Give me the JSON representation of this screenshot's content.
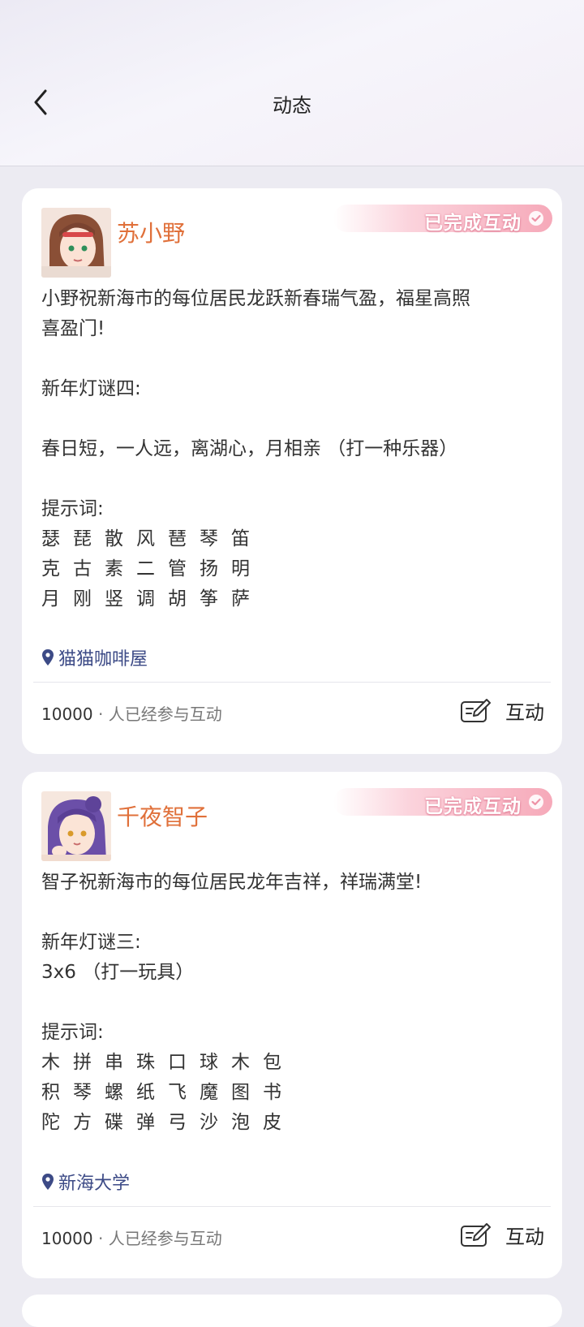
{
  "header": {
    "title": "动态"
  },
  "posts": [
    {
      "author": "苏小野",
      "badge": "已完成互动",
      "body": [
        "小野祝新海市的每位居民龙跃新春瑞气盈，福星高照",
        "喜盈门!",
        "",
        "新年灯谜四:",
        "",
        "春日短，一人远，离湖心，月相亲 （打一种乐器）",
        "",
        "提示词:"
      ],
      "hints": [
        [
          "瑟",
          "琵",
          "散",
          "风",
          "琶",
          "琴",
          "笛"
        ],
        [
          "克",
          "古",
          "素",
          "二",
          "管",
          "扬",
          "明"
        ],
        [
          "月",
          "刚",
          "竖",
          "调",
          "胡",
          "筝",
          "萨"
        ]
      ],
      "location": "猫猫咖啡屋",
      "count": "10000",
      "count_suffix": "· 人已经参与互动",
      "interact_label": "互动"
    },
    {
      "author": "千夜智子",
      "badge": "已完成互动",
      "body": [
        "智子祝新海市的每位居民龙年吉祥，祥瑞满堂!",
        "",
        "新年灯谜三:",
        "3x6 （打一玩具）",
        "",
        "提示词:"
      ],
      "hints": [
        [
          "木",
          "拼",
          "串",
          "珠",
          "口",
          "球",
          "木",
          "包"
        ],
        [
          "积",
          "琴",
          "螺",
          "纸",
          "飞",
          "魔",
          "图",
          "书"
        ],
        [
          "陀",
          "方",
          "碟",
          "弹",
          "弓",
          "沙",
          "泡",
          "皮"
        ]
      ],
      "location": "新海大学",
      "count": "10000",
      "count_suffix": "· 人已经参与互动",
      "interact_label": "互动"
    }
  ],
  "colors": {
    "author": "#e0703a",
    "location": "#3c4a86",
    "badge": "#f6a9b9"
  }
}
